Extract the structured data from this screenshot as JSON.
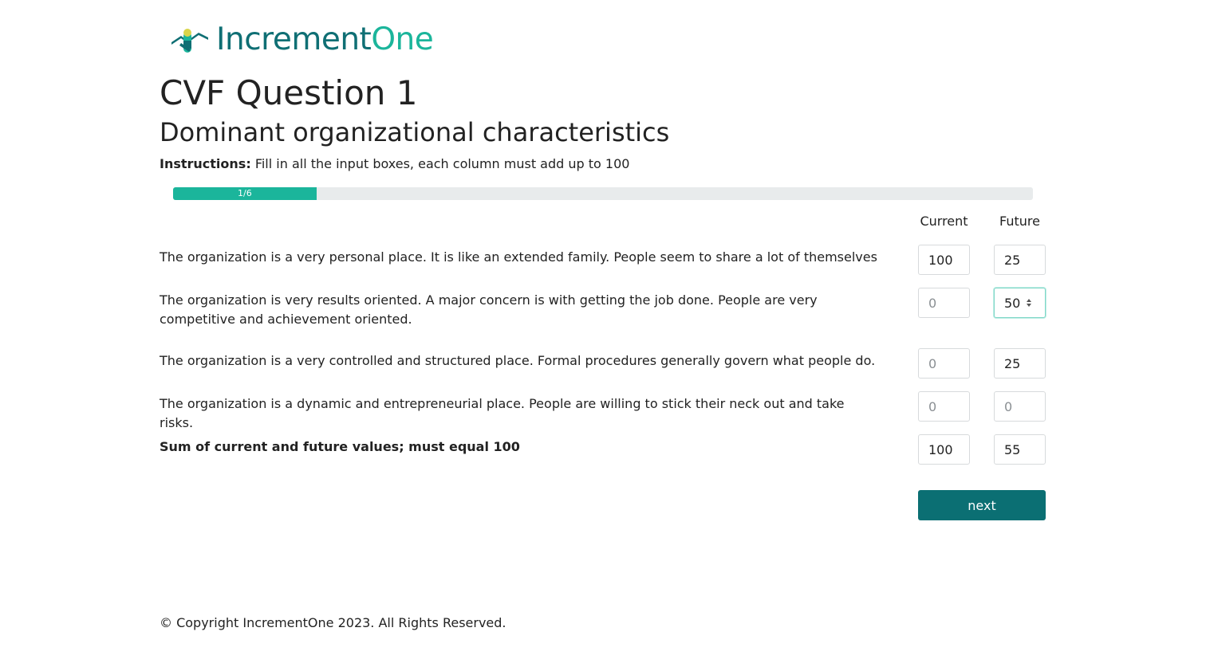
{
  "logo": {
    "text_main": "Increment",
    "text_accent": "One",
    "icon": "incrementone-logo-icon",
    "colors": {
      "dark": "#0f6f74",
      "accent": "#1bb59b",
      "yellow": "#d9d54a"
    }
  },
  "page": {
    "title": "CVF Question 1",
    "subtitle": "Dominant organizational characteristics",
    "instructions_label": "Instructions:",
    "instructions_text": "Fill in all the input boxes, each column must add up to 100"
  },
  "progress": {
    "label": "1/6",
    "fraction": 0.1667
  },
  "columns": {
    "current": "Current",
    "future": "Future"
  },
  "rows": [
    {
      "text": "The organization is a very personal place. It is like an extended family. People seem to share a lot of themselves",
      "current": {
        "value": "100",
        "placeholder": "0"
      },
      "future": {
        "value": "25",
        "placeholder": "0"
      }
    },
    {
      "text": "The organization is very results oriented. A major concern is with getting the job done. People are very competitive and achievement oriented.",
      "current": {
        "value": "",
        "placeholder": "0"
      },
      "future": {
        "value": "50",
        "placeholder": "0"
      }
    },
    {
      "text": "The organization is a very controlled and structured place. Formal procedures generally govern what people do.",
      "current": {
        "value": "",
        "placeholder": "0"
      },
      "future": {
        "value": "25",
        "placeholder": "0"
      }
    },
    {
      "text": "The organization is a dynamic and entrepreneurial place. People are willing to stick their neck out and take risks.",
      "current": {
        "value": "",
        "placeholder": "0"
      },
      "future": {
        "value": "",
        "placeholder": "0"
      }
    }
  ],
  "sum": {
    "label": "Sum of current and future values; must equal 100",
    "current": "100",
    "future": "55"
  },
  "buttons": {
    "next": "next"
  },
  "footer": {
    "copyright": "© Copyright IncrementOne 2023. All Rights Reserved."
  },
  "colors": {
    "accent": "#1bb59b",
    "button": "#0b6f73",
    "progress_track": "#e8ebec"
  }
}
